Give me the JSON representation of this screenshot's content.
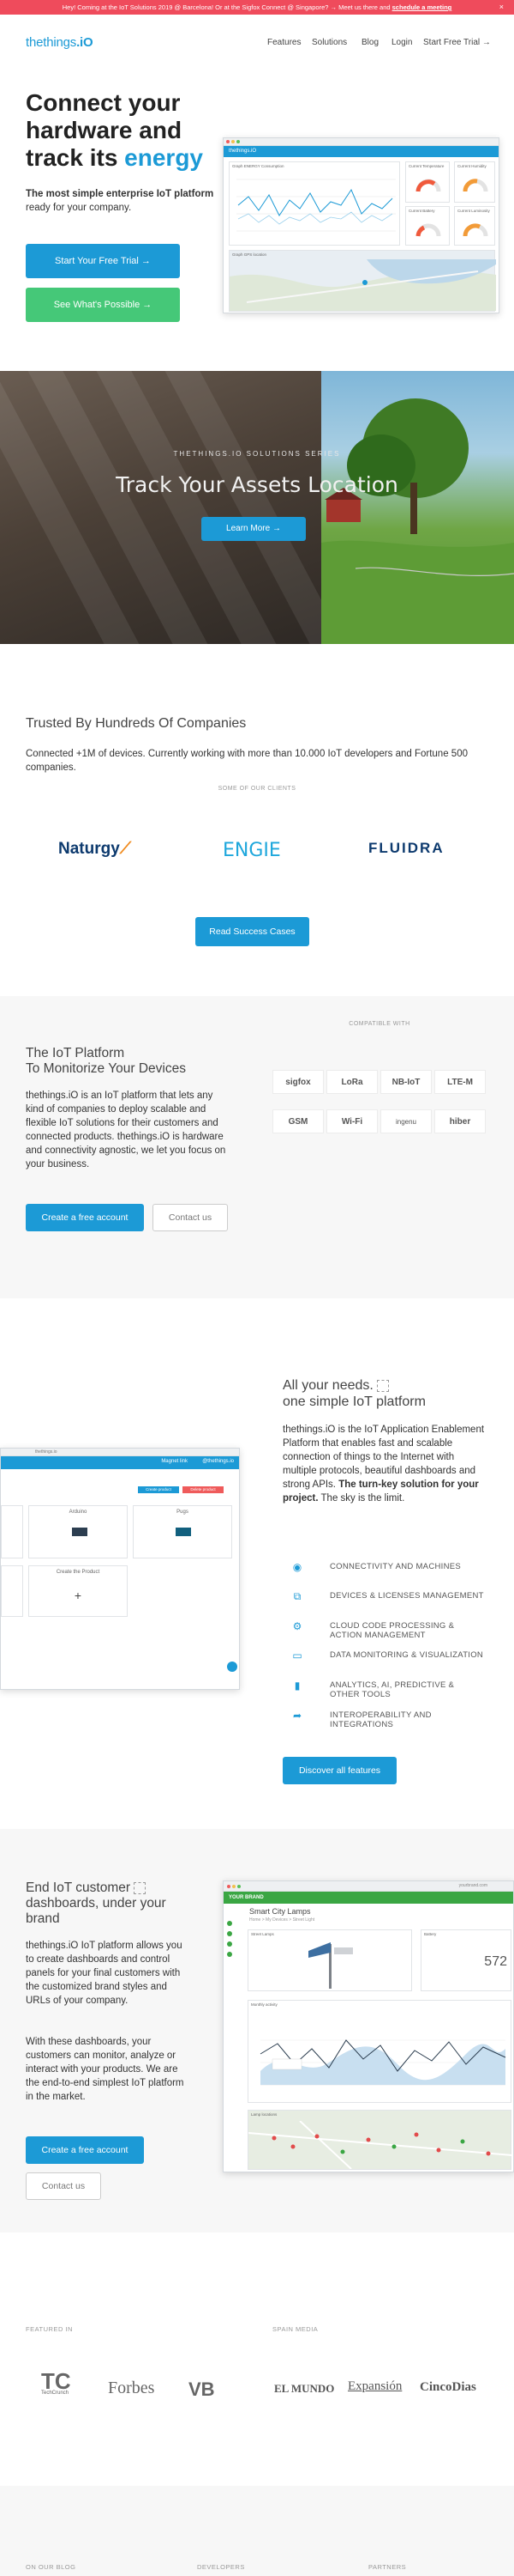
{
  "banner": {
    "text": "Hey! Coming at the IoT Solutions 2019 @ Barcelona! Or at the Sigfox Connect @ Singapore? → Meet us there and",
    "link": "schedule a meeting",
    "close": "×"
  },
  "header": {
    "logo_main": "thethings",
    "logo_suffix": ".iO",
    "nav": [
      "Features",
      "Solutions",
      "Blog",
      "Login",
      "Start Free Trial →"
    ]
  },
  "hero": {
    "title_pre": "Connect your hardware and track its ",
    "title_accent": "energy",
    "sub_bold": "The most simple enterprise IoT platform",
    "sub_rest": " ready for your company.",
    "btn_trial": "Start Your Free Trial →",
    "btn_possible": "See What's Possible →",
    "mock_brand": "thethings.iO",
    "mock_cards": [
      "Graph ENERGY Consumption",
      "Current Temperature",
      "Current Humidity",
      "Current Battery",
      "Current Luminosity",
      "Graph GPS location"
    ]
  },
  "track": {
    "kicker": "THETHINGS.IO SOLUTIONS SERIES",
    "title": "Track Your Assets Location",
    "btn": "Learn More →"
  },
  "trusted": {
    "title": "Trusted By Hundreds Of Companies",
    "text": "Connected +1M of devices. Currently working with more than 10.000 IoT developers and Fortune 500 companies.",
    "clients_label": "SOME OF OUR CLIENTS",
    "clients": [
      "Naturgy",
      "ENGIE",
      "FLUIDRA"
    ],
    "btn": "Read Success Cases"
  },
  "platform": {
    "title_line1": "The IoT Platform",
    "title_line2": "To Monitorize Your Devices",
    "text": "thethings.iO is an IoT platform that lets any kind of companies to deploy scalable and flexible IoT solutions for their customers and connected products. thethings.iO is hardware and connectivity agnostic, we let you focus on your business.",
    "btn_create": "Create a free account",
    "btn_contact": "Contact us",
    "compatible_label": "COMPATIBLE WITH",
    "compatible": [
      "sigfox",
      "LoRa",
      "NB-IoT",
      "LTE-M",
      "GSM",
      "Wi-Fi",
      "ingenu",
      "hiber"
    ]
  },
  "needs": {
    "title_line1": "All your needs.",
    "title_line2": "one simple IoT platform",
    "text_pre": "thethings.iO is the IoT Application Enablement Platform that enables fast and scalable connection of things to the Internet with multiple protocols, beautiful dashboards and strong APIs. ",
    "text_bold": "The turn-key solution for your project.",
    "text_post": " The sky is the limit.",
    "features": [
      {
        "icon": "rss-icon",
        "glyph": "◉",
        "label": "CONNECTIVITY AND MACHINES"
      },
      {
        "icon": "sitemap-icon",
        "glyph": "⧉",
        "label": "DEVICES & LICENSES MANAGEMENT"
      },
      {
        "icon": "gear-icon",
        "glyph": "⚙",
        "label": "CLOUD CODE PROCESSING & ACTION MANAGEMENT"
      },
      {
        "icon": "monitor-icon",
        "glyph": "▭",
        "label": "DATA MONITORING & VISUALIZATION"
      },
      {
        "icon": "bar-chart-icon",
        "glyph": "▮",
        "label": "ANALYTICS, AI, PREDICTIVE & OTHER TOOLS"
      },
      {
        "icon": "share-icon",
        "glyph": "➦",
        "label": "INTEROPERABILITY AND INTEGRATIONS"
      }
    ],
    "btn": "Discover all features",
    "mock_app_title": "thethings.io",
    "mock_top_btn": "Magnet link",
    "mock_user": "@thethings.io",
    "mock_tag_blue": "Create product",
    "mock_tag_red": "Delete product",
    "mock_items": [
      "Arduino",
      "Pugs",
      "Create the Product"
    ]
  },
  "brand": {
    "title_line1": "End IoT customer",
    "title_line2": "dashboards, under your",
    "title_line3": "brand",
    "text1": "thethings.iO IoT platform allows you to create dashboards and control panels for your final customers with the customized brand styles and URLs of your company.",
    "text2": "With these dashboards, your customers can monitor, analyze or interact with your products. We are the end-to-end simplest IoT platform in the market.",
    "btn_create": "Create a free account",
    "btn_contact": "Contact us",
    "mock_url": "yourbrand.com",
    "mock_header": "YOUR BRAND",
    "mock_app_title": "Smart City Lamps",
    "mock_breadcrumb": "Home > My Devices > Street Light",
    "card_streetlight": "Street Lamps",
    "card_battery": "Battery",
    "card_battery_value": "572",
    "card_graph": "Monthly activity",
    "card_map": "Lamp locations"
  },
  "featured": {
    "label_left": "FEATURED IN",
    "label_right": "SPAIN MEDIA",
    "press_left": [
      "TechCrunch",
      "Forbes",
      "VB"
    ],
    "press_right": [
      "EL MUNDO",
      "Expansión",
      "CincoDias"
    ]
  },
  "footer": {
    "cols": [
      "ON OUR BLOG",
      "DEVELOPERS",
      "PARTNERS"
    ]
  },
  "colors": {
    "accent": "#1c9ad6",
    "green": "#45c878",
    "banner": "#ef4b5c"
  }
}
